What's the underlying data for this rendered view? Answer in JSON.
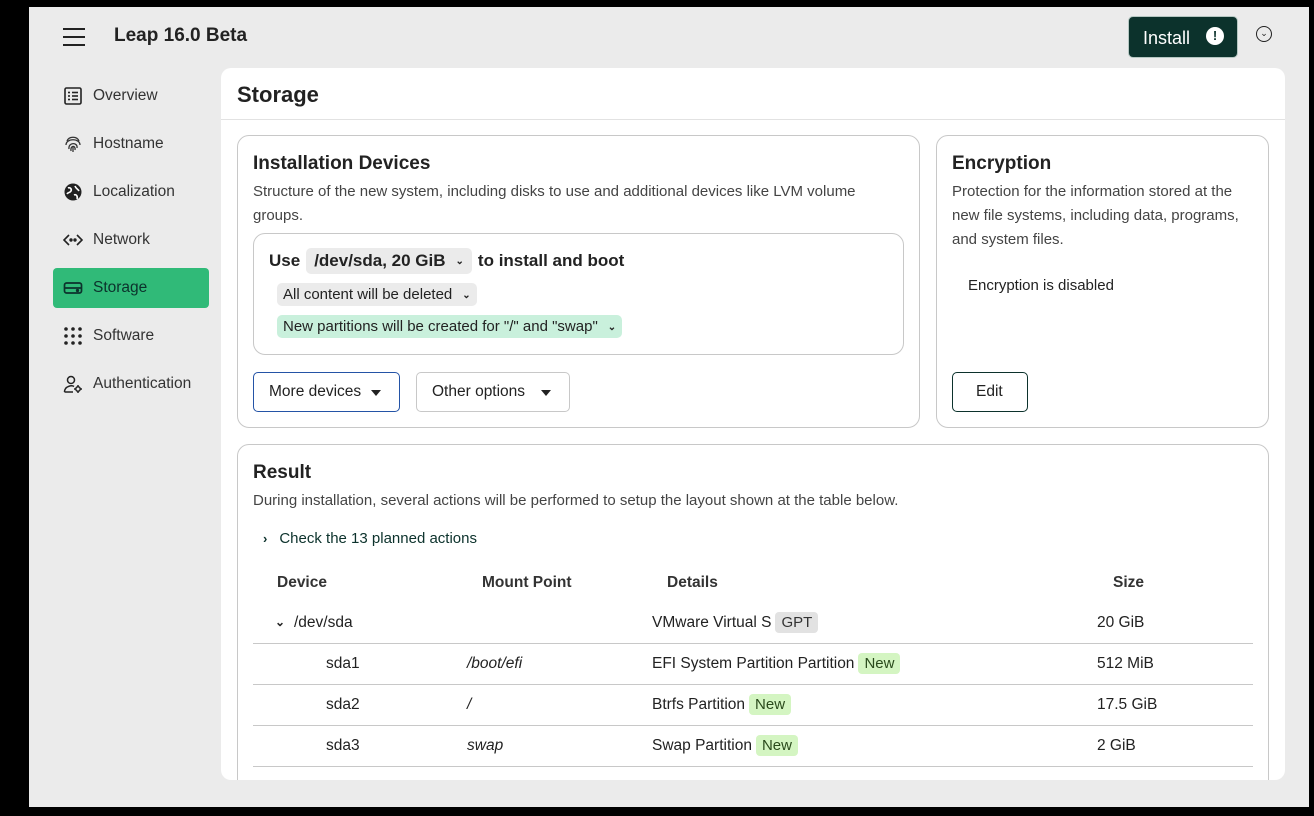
{
  "app": {
    "title": "Leap 16.0 Beta",
    "install_label": "Install",
    "install_warning": "!"
  },
  "sidebar": {
    "items": [
      {
        "label": "Overview",
        "icon": "list-icon",
        "active": false
      },
      {
        "label": "Hostname",
        "icon": "fingerprint-icon",
        "active": false
      },
      {
        "label": "Localization",
        "icon": "globe-icon",
        "active": false
      },
      {
        "label": "Network",
        "icon": "code-arrows-icon",
        "active": false
      },
      {
        "label": "Storage",
        "icon": "hard-drive-icon",
        "active": true
      },
      {
        "label": "Software",
        "icon": "apps-grid-icon",
        "active": false
      },
      {
        "label": "Authentication",
        "icon": "user-gear-icon",
        "active": false
      }
    ]
  },
  "page": {
    "title": "Storage"
  },
  "installation": {
    "title": "Installation Devices",
    "description_1": "Structure of the new system, including disks to use and additional devices like LVM volume",
    "description_2": "groups.",
    "use_prefix": "Use",
    "device": "/dev/sda, 20 GiB",
    "use_suffix": "to install and boot",
    "content_policy": "All content will be deleted",
    "partitions_policy": "New partitions will be created for \"/\" and \"swap\"",
    "more_devices": "More devices",
    "other_options": "Other options"
  },
  "encryption": {
    "title": "Encryption",
    "desc_1": "Protection for the information stored at the",
    "desc_2": "new file systems, including data, programs,",
    "desc_3": "and system files.",
    "status": "Encryption is disabled",
    "edit": "Edit"
  },
  "result": {
    "title": "Result",
    "description": "During installation, several actions will be performed to setup the layout shown at the table below.",
    "actions_toggle": "Check the 13 planned actions",
    "columns": [
      "Device",
      "Mount Point",
      "Details",
      "Size"
    ],
    "rows": [
      {
        "device": "/dev/sda",
        "mount": "",
        "details": "VMware Virtual S",
        "badge": "GPT",
        "size": "20 GiB"
      },
      {
        "device": "sda1",
        "mount": "/boot/efi",
        "details": "EFI System Partition Partition",
        "badge": "New",
        "size": "512 MiB"
      },
      {
        "device": "sda2",
        "mount": "/",
        "details": "Btrfs Partition",
        "badge": "New",
        "size": "17.5 GiB"
      },
      {
        "device": "sda3",
        "mount": "swap",
        "details": "Swap Partition",
        "badge": "New",
        "size": "2 GiB"
      }
    ]
  },
  "colors": {
    "accent": "#30ba78",
    "brand_dark": "#0c322c",
    "badge_new": "#d4f5c2",
    "chip_green": "#c9f0dc"
  }
}
